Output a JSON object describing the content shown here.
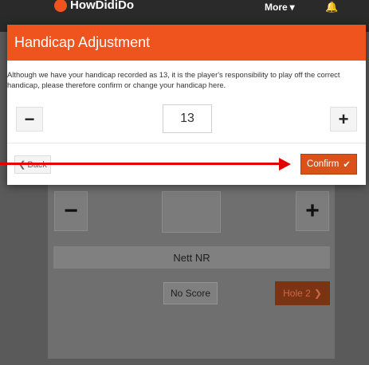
{
  "app": {
    "logo_text": "HowDidiDo",
    "more_label": "More",
    "bell_icon": "bell-icon"
  },
  "modal": {
    "title": "Handicap Adjustment",
    "message": "Although we have your handicap recorded as 13, it is the player's responsibility to play off the correct handicap, please therefore confirm or change your handicap here.",
    "decrement_symbol": "−",
    "increment_symbol": "+",
    "handicap_value": "13",
    "back_label": "Back",
    "back_icon": "chevron-left-icon",
    "confirm_label": "Confirm",
    "confirm_icon": "check-icon"
  },
  "background": {
    "decrement_symbol": "−",
    "increment_symbol": "+",
    "nett_label": "Nett NR",
    "no_score_label": "No Score",
    "hole_label": "Hole 2",
    "hole_icon": "chevron-right-icon"
  },
  "colors": {
    "accent": "#f0541e",
    "confirm": "#d9521a",
    "annotation_arrow": "#e40000"
  }
}
